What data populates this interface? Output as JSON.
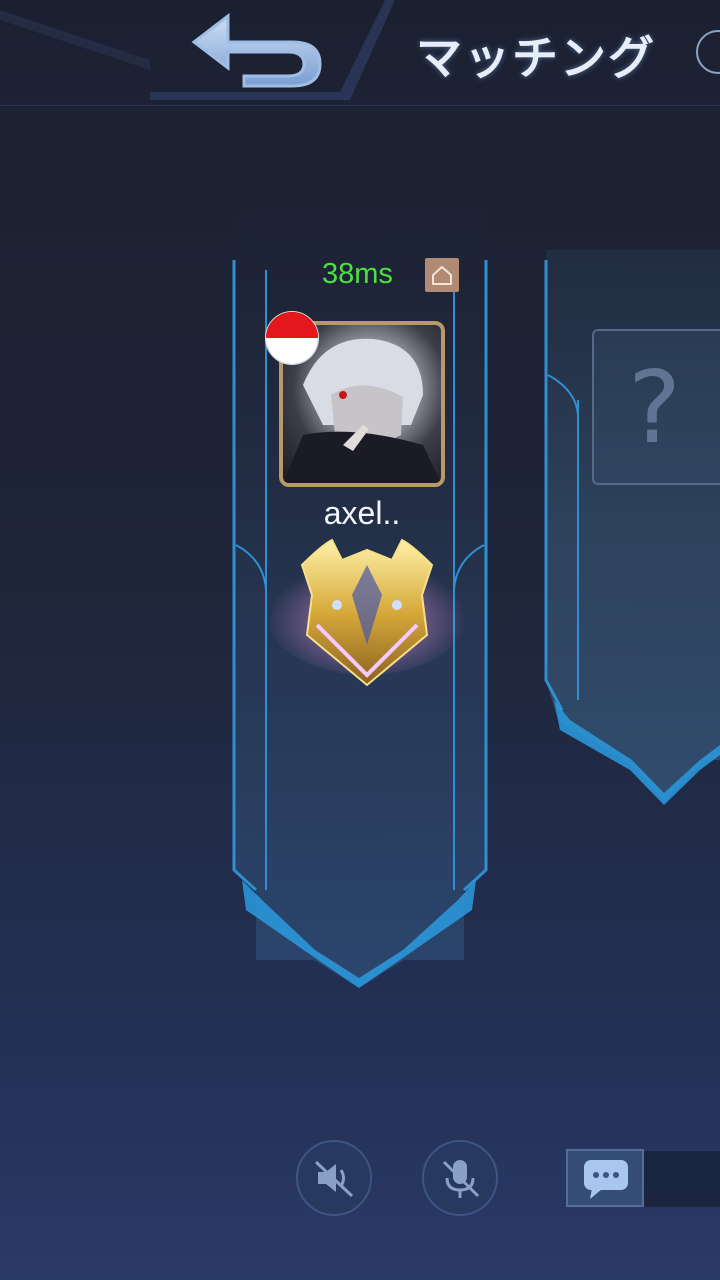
{
  "header": {
    "title": "マッチング",
    "back_icon": "back-arrow-icon",
    "refresh_icon": "refresh-icon"
  },
  "player_slot": {
    "ping": "38ms",
    "ping_color": "#4de043",
    "home_icon": "home-icon",
    "flag": "indonesia-flag",
    "name": "axel..",
    "rank_icon": "rank-badge-icon"
  },
  "empty_slot": {
    "placeholder": "?"
  },
  "controls": {
    "speaker_icon": "speaker-muted-icon",
    "mic_icon": "mic-muted-icon",
    "chat_icon": "chat-icon"
  },
  "colors": {
    "accent": "#2fa8e8",
    "frame_gold": "#b89a6a"
  }
}
